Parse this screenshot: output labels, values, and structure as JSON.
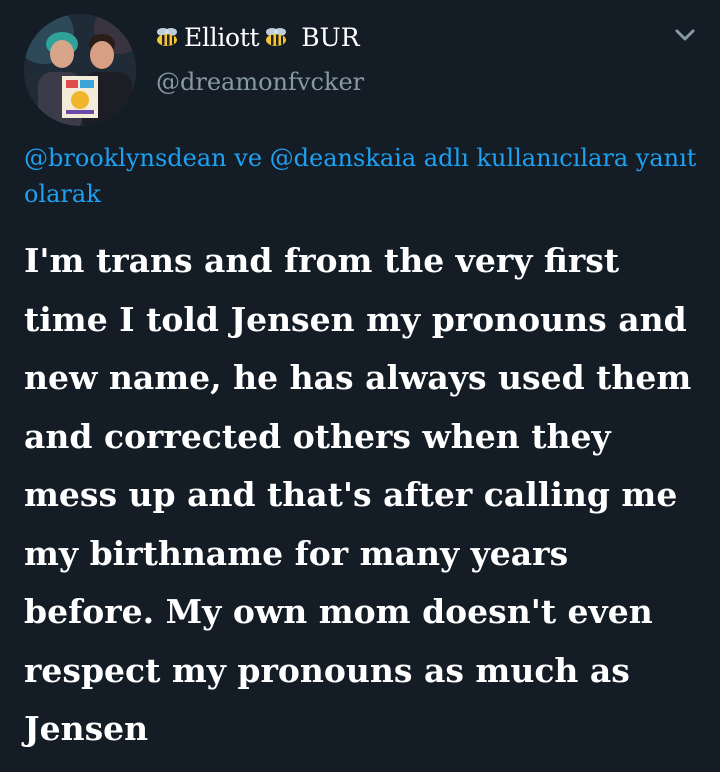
{
  "user": {
    "display_name": "Elliott",
    "name_badge": "BUR",
    "handle": "@dreamonfvcker",
    "avatar_icon": "profile-photo",
    "name_emoji": "bee-icon"
  },
  "tweet": {
    "reply_mention_1": "@brooklynsdean",
    "reply_joiner": "ve",
    "reply_mention_2": "@deanskaia",
    "reply_suffix": "adlı kullanıcılara yanıt olarak",
    "text": "I'm trans and from the very first time I told Jensen my pronouns and new name, he has always used them and corrected others when they mess up and that's after calling me my birthname for many years before. My own mom doesn't even respect my pronouns as much as Jensen"
  },
  "colors": {
    "background": "#141d26",
    "text_primary": "#ffffff",
    "text_secondary": "#8899a6",
    "link": "#1da1f2"
  }
}
